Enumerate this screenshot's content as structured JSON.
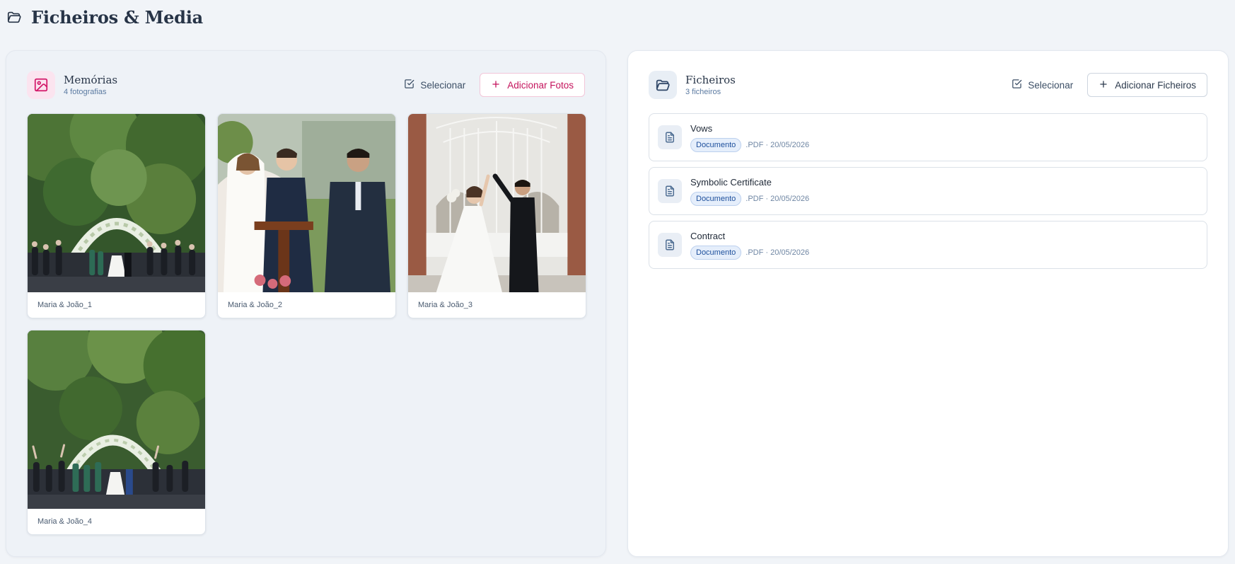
{
  "page": {
    "title": "Ficheiros & Media",
    "icon": "folder-open-icon"
  },
  "memories": {
    "title": "Memórias",
    "subtitle": "4 fotografias",
    "icon": "image-icon",
    "select_label": "Selecionar",
    "add_label": "Adicionar Fotos",
    "accent_color": "#c4135c",
    "photos": [
      {
        "caption": "Maria & João_1"
      },
      {
        "caption": "Maria & João_2"
      },
      {
        "caption": "Maria & João_3"
      },
      {
        "caption": "Maria & João_4"
      }
    ]
  },
  "files": {
    "title": "Ficheiros",
    "subtitle": "3 ficheiros",
    "icon": "folder-open-icon",
    "select_label": "Selecionar",
    "add_label": "Adicionar Ficheiros",
    "items": [
      {
        "name": "Vows",
        "type": "Documento",
        "meta": ".PDF · 20/05/2026",
        "icon": "document-icon"
      },
      {
        "name": "Symbolic Certificate",
        "type": "Documento",
        "meta": ".PDF · 20/05/2026",
        "icon": "document-icon"
      },
      {
        "name": "Contract",
        "type": "Documento",
        "meta": ".PDF · 20/05/2026",
        "icon": "document-icon"
      }
    ]
  }
}
